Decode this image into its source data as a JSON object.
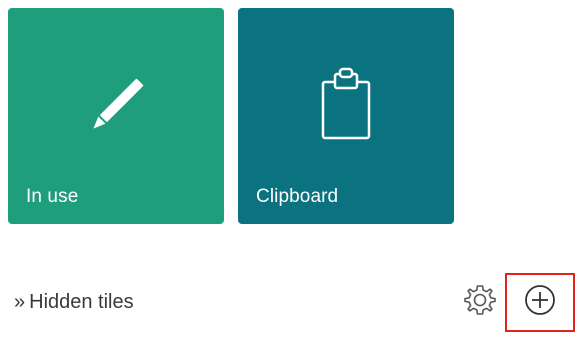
{
  "tiles": [
    {
      "label": "In use",
      "icon": "pencil-icon",
      "color": "#1f9e7e"
    },
    {
      "label": "Clipboard",
      "icon": "clipboard-icon",
      "color": "#0b7380"
    }
  ],
  "footer": {
    "hidden_tiles_chevron": "»",
    "hidden_tiles_label": "Hidden tiles",
    "settings_icon": "gear-icon",
    "add_icon": "plus-circle-icon",
    "highlight_color": "#e2231a"
  }
}
